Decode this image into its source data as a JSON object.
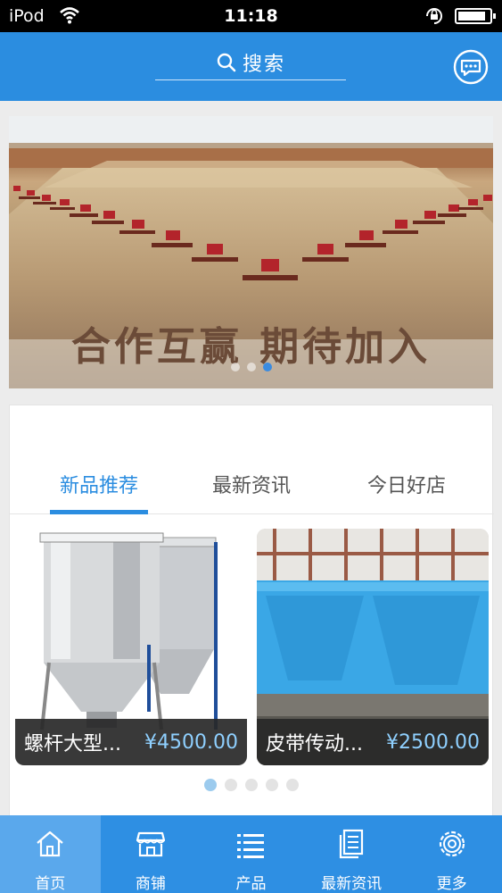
{
  "status_bar": {
    "carrier": "iPod",
    "time": "11:18"
  },
  "header": {
    "search_label": "搜索",
    "icons": {
      "search": "search-icon",
      "chat": "chat-bubble-icon"
    }
  },
  "banner": {
    "caption": "合作互赢 期待加入",
    "slide_count": 3,
    "active_slide": 2
  },
  "tabs": [
    {
      "label": "新品推荐",
      "active": true
    },
    {
      "label": "最新资讯",
      "active": false
    },
    {
      "label": "今日好店",
      "active": false
    }
  ],
  "products": [
    {
      "name": "螺杆大型...",
      "price": "¥4500.00"
    },
    {
      "name": "皮带传动...",
      "price": "¥2500.00"
    }
  ],
  "product_pager": {
    "count": 5,
    "active": 0
  },
  "bottom_nav": [
    {
      "label": "首页",
      "icon": "home-icon",
      "active": true
    },
    {
      "label": "商铺",
      "icon": "storefront-icon",
      "active": false
    },
    {
      "label": "产品",
      "icon": "list-icon",
      "active": false
    },
    {
      "label": "最新资讯",
      "icon": "document-icon",
      "active": false
    },
    {
      "label": "更多",
      "icon": "gear-icon",
      "active": false
    }
  ],
  "colors": {
    "primary": "#2b8de0",
    "nav_active": "#5aa8ec",
    "price": "#8fd0ff",
    "caption": "#6b4b38"
  }
}
